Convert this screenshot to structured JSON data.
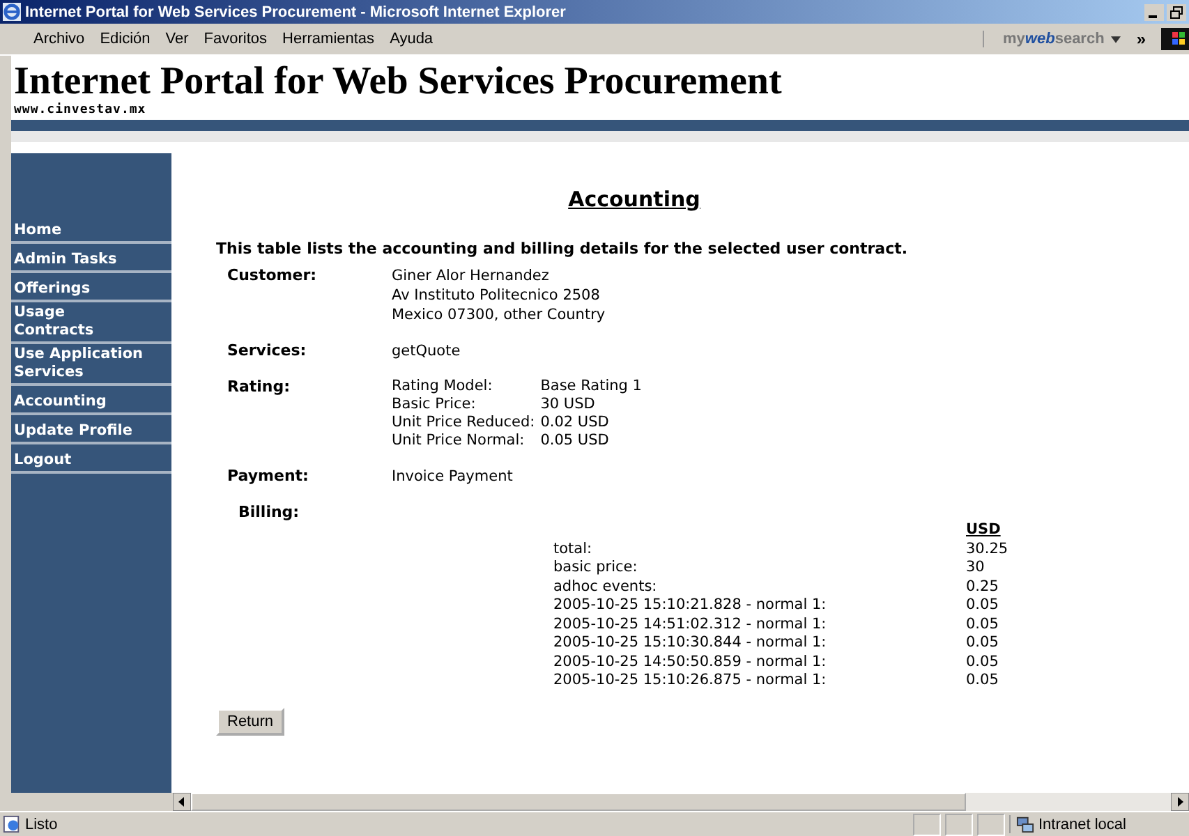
{
  "window": {
    "title": "Internet Portal for Web Services Procurement - Microsoft Internet Explorer"
  },
  "menu": [
    "Archivo",
    "Edición",
    "Ver",
    "Favoritos",
    "Herramientas",
    "Ayuda"
  ],
  "toolbar": {
    "search_brand_prefix": "my",
    "search_brand_emph": "web",
    "search_brand_suffix": "search",
    "chevron": "»"
  },
  "header": {
    "title": "Internet Portal for Web Services Procurement",
    "site": "www.cinvestav.mx"
  },
  "sidebar": {
    "items": [
      "Home",
      "Admin Tasks",
      "Offerings",
      "Usage Contracts",
      "Use Application Services",
      "Accounting",
      "Update Profile",
      "Logout"
    ]
  },
  "page": {
    "heading": "Accounting",
    "intro": "This table lists the accounting and billing details for the selected user contract.",
    "details": [
      {
        "label": "Customer:",
        "kind": "lines",
        "lines": [
          "Giner Alor Hernandez",
          "Av Instituto Politecnico 2508",
          "Mexico 07300, other Country"
        ]
      },
      {
        "label": "Services:",
        "kind": "lines",
        "lines": [
          "getQuote"
        ]
      },
      {
        "label": "Rating:",
        "kind": "pairs",
        "pairs": [
          [
            "Rating Model:",
            "Base Rating 1"
          ],
          [
            "Basic Price:",
            "30 USD"
          ],
          [
            "Unit Price Reduced:",
            "0.02 USD"
          ],
          [
            "Unit Price Normal:",
            "0.05 USD"
          ]
        ]
      },
      {
        "label": "Payment:",
        "kind": "lines",
        "lines": [
          "Invoice Payment"
        ]
      }
    ],
    "billing": {
      "label": "Billing:",
      "currency": "USD",
      "rows": [
        [
          "total:",
          "30.25"
        ],
        [
          "basic price:",
          "30"
        ],
        [
          "adhoc events:",
          "0.25"
        ],
        [
          "2005-10-25 15:10:21.828 - normal 1:",
          "0.05"
        ],
        [
          "2005-10-25 14:51:02.312 - normal 1:",
          "0.05"
        ],
        [
          "2005-10-25 15:10:30.844 - normal 1:",
          "0.05"
        ],
        [
          "2005-10-25 14:50:50.859 - normal 1:",
          "0.05"
        ],
        [
          "2005-10-25 15:10:26.875 - normal 1:",
          "0.05"
        ]
      ]
    },
    "button": "Return"
  },
  "status_bar": {
    "text": "Listo",
    "zone": "Intranet local"
  }
}
